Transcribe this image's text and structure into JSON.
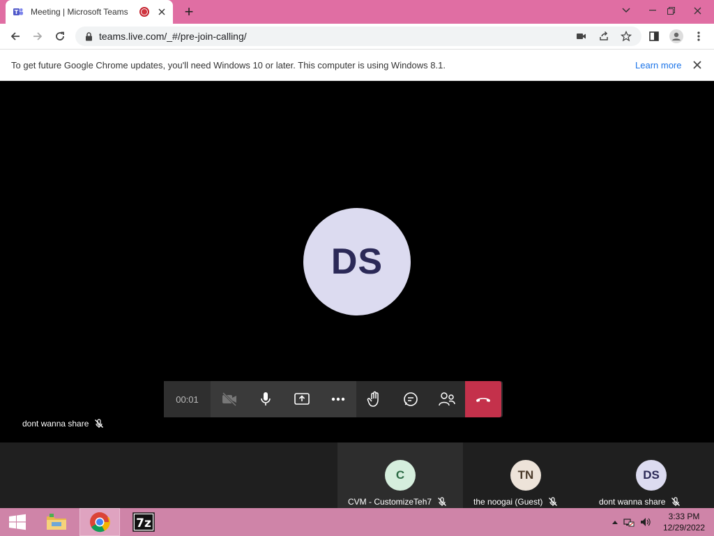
{
  "browser": {
    "tab_title": "Meeting | Microsoft Teams",
    "new_tab": "+",
    "url": "teams.live.com/_#/pre-join-calling/"
  },
  "infobar": {
    "message": "To get future Google Chrome updates, you'll need Windows 10 or later. This computer is using Windows 8.1.",
    "link": "Learn more"
  },
  "meeting": {
    "main_initials": "DS",
    "timer": "00:01",
    "self_name": "dont wanna share",
    "colors": {
      "hangup": "#c4314b",
      "avatar_bg": "#dcdbf0"
    }
  },
  "participants": [
    {
      "initials": "C",
      "name": "CVM - CustomizeTeh7",
      "bg": "#d5eedd",
      "fg": "#2d6b46"
    },
    {
      "initials": "TN",
      "name": "the noogai (Guest)",
      "bg": "#ede3d9",
      "fg": "#4a3a2a"
    },
    {
      "initials": "DS",
      "name": "dont wanna share",
      "bg": "#dcdbf0",
      "fg": "#2b2957"
    }
  ],
  "taskbar": {
    "time": "3:33 PM",
    "date": "12/29/2022"
  }
}
